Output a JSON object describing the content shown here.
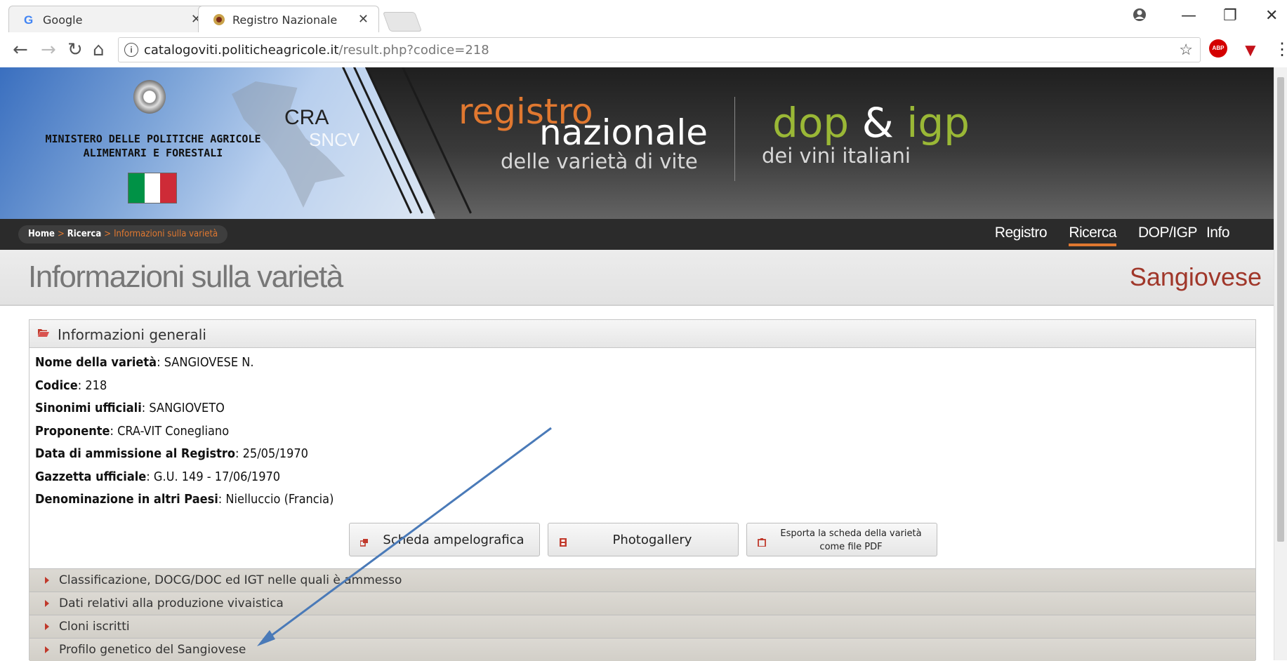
{
  "browser": {
    "tabs": [
      {
        "title": "Google",
        "icon": "google-g-icon"
      },
      {
        "title": "Registro Nazionale delle",
        "icon": "site-favicon-icon"
      }
    ],
    "address": {
      "host": "catalogoviti.politicheagricole.it",
      "path": "/result.php?codice=218"
    }
  },
  "header": {
    "ministry_line1": "MINISTERO DELLE POLITICHE AGRICOLE",
    "ministry_line2": "ALIMENTARI E FORESTALI",
    "cra_logo": "CRA",
    "sncv_logo": "SNCV",
    "registro_word1": "registro",
    "registro_word2": "nazionale",
    "registro_word3": "delle varietà di vite",
    "dop_word1": "dop",
    "dop_amp": "&",
    "dop_word2": "igp",
    "dop_word3": "dei vini italiani",
    "flag_colors": [
      "#009246",
      "#ffffff",
      "#ce2b37"
    ]
  },
  "breadcrumb": {
    "home": "Home",
    "ricerca": "Ricerca",
    "current": "Informazioni sulla varietà",
    "separator": ">"
  },
  "nav": {
    "items": [
      "Registro",
      "Ricerca",
      "DOP/IGP",
      "Info"
    ],
    "active": "Ricerca"
  },
  "page": {
    "title": "Informazioni sulla varietà",
    "variety": "Sangiovese"
  },
  "general": {
    "heading": "Informazioni generali",
    "fields": [
      {
        "label": "Nome della varietà",
        "value": "SANGIOVESE N."
      },
      {
        "label": "Codice",
        "value": "218"
      },
      {
        "label": "Sinonimi ufficiali",
        "value": "SANGIOVETO"
      },
      {
        "label": "Proponente",
        "value": "CRA-VIT Conegliano"
      },
      {
        "label": "Data di ammissione al Registro",
        "value": "25/05/1970"
      },
      {
        "label": "Gazzetta ufficiale",
        "value": "G.U. 149 - 17/06/1970"
      },
      {
        "label": "Denominazione in altri Paesi",
        "value": "Nielluccio (Francia)"
      }
    ]
  },
  "actions": {
    "scheda": "Scheda ampelografica",
    "photogallery": "Photogallery",
    "export_line1": "Esporta la scheda della varietà",
    "export_line2": "come file PDF"
  },
  "sections": [
    "Classificazione, DOCG/DOC ed IGT nelle quali è ammesso",
    "Dati relativi alla produzione vivaistica",
    "Cloni iscritti",
    "Profilo genetico del Sangiovese"
  ],
  "colors": {
    "accent_orange": "#e07830",
    "variety_red": "#a0372a",
    "dop_green": "#9ab836",
    "annotation_arrow": "#4a7ab8"
  }
}
